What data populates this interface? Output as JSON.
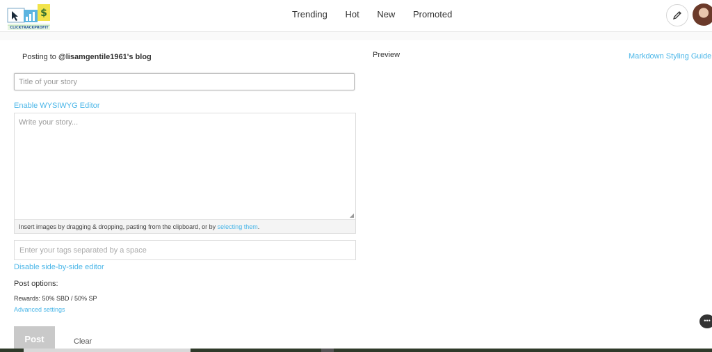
{
  "header": {
    "logo_text": "CLICKTRACKPROFIT",
    "nav": [
      "Trending",
      "Hot",
      "New",
      "Promoted"
    ]
  },
  "editor": {
    "posting_prefix": "Posting to ",
    "posting_blog": "@lisamgentile1961's blog",
    "title_placeholder": "Title of your story",
    "wysiwyg_link": "Enable WYSIWYG Editor",
    "body_placeholder": "Write your story...",
    "drop_hint_prefix": "Insert images by dragging & dropping, pasting from the clipboard, or by ",
    "drop_hint_link": "selecting them",
    "drop_hint_suffix": ".",
    "tags_placeholder": "Enter your tags separated by a space",
    "side_by_side_link": "Disable side-by-side editor",
    "post_options_label": "Post options:",
    "rewards": "Rewards: 50% SBD / 50% SP",
    "advanced_link": "Advanced settings",
    "post_button": "Post",
    "clear_button": "Clear"
  },
  "preview": {
    "label": "Preview",
    "markdown_link": "Markdown Styling Guide"
  },
  "colors": {
    "accent_link": "#4ab6e8",
    "post_button_disabled": "#c9c9c9"
  }
}
